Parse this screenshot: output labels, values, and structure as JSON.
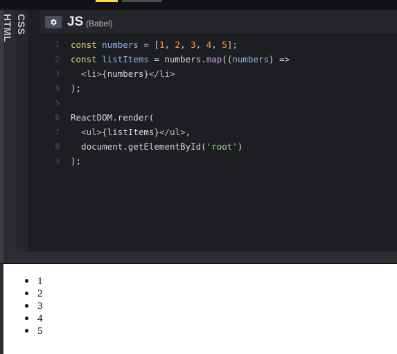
{
  "panels": {
    "html_label": "HTML",
    "css_label": "CSS"
  },
  "editor": {
    "title": "JS",
    "subtitle": "(Babel)",
    "settings_icon": "gear-icon",
    "lines": [
      {
        "n": "1",
        "parts": [
          [
            "kw",
            "const "
          ],
          [
            "var",
            "numbers"
          ],
          [
            "fn",
            " = ["
          ],
          [
            "num",
            "1"
          ],
          [
            "fn",
            ", "
          ],
          [
            "num",
            "2"
          ],
          [
            "fn",
            ", "
          ],
          [
            "num",
            "3"
          ],
          [
            "fn",
            ", "
          ],
          [
            "num",
            "4"
          ],
          [
            "fn",
            ", "
          ],
          [
            "num",
            "5"
          ],
          [
            "fn",
            "];"
          ]
        ]
      },
      {
        "n": "2",
        "parts": [
          [
            "kw",
            "const "
          ],
          [
            "var",
            "listItems"
          ],
          [
            "fn",
            " = numbers."
          ],
          [
            "call",
            "map"
          ],
          [
            "fn",
            "(("
          ],
          [
            "var",
            "numbers"
          ],
          [
            "fn",
            ") =>"
          ]
        ]
      },
      {
        "n": "3",
        "parts": [
          [
            "fn",
            "  "
          ],
          [
            "tag",
            "<li>"
          ],
          [
            "fn",
            "{numbers}"
          ],
          [
            "tag",
            "</li>"
          ]
        ]
      },
      {
        "n": "4",
        "parts": [
          [
            "fn",
            ");"
          ]
        ]
      },
      {
        "n": "5",
        "parts": []
      },
      {
        "n": "6",
        "parts": [
          [
            "fn",
            "ReactDOM.render("
          ]
        ]
      },
      {
        "n": "7",
        "parts": [
          [
            "fn",
            "  "
          ],
          [
            "tag",
            "<ul>"
          ],
          [
            "fn",
            "{listItems}"
          ],
          [
            "tag",
            "</ul>"
          ],
          [
            "fn",
            ","
          ]
        ]
      },
      {
        "n": "8",
        "parts": [
          [
            "fn",
            "  document.getElementById("
          ],
          [
            "str",
            "'root'"
          ],
          [
            "fn",
            ")"
          ]
        ]
      },
      {
        "n": "9",
        "parts": [
          [
            "fn",
            ");"
          ]
        ]
      }
    ]
  },
  "preview": {
    "items": [
      "1",
      "2",
      "3",
      "4",
      "5"
    ]
  }
}
